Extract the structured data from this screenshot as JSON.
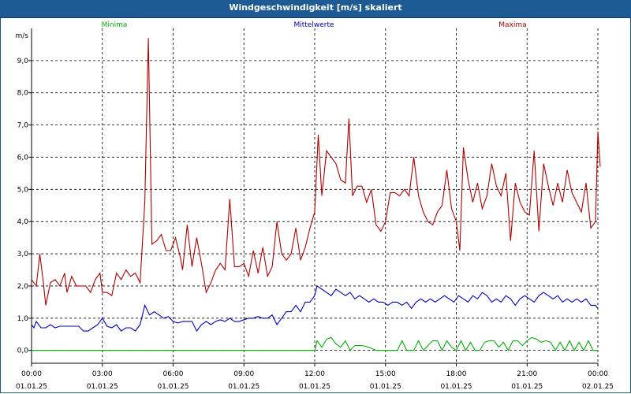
{
  "window": {
    "title": "Windgeschwindigkeit [m/s] skaliert"
  },
  "chart_data": {
    "type": "line",
    "title": "Windgeschwindigkeit [m/s] skaliert",
    "ylabel": "m/s",
    "ylim": [
      -0.4,
      10.0
    ],
    "y_ticks": [
      "0,0",
      "1,0",
      "2,0",
      "3,0",
      "4,0",
      "5,0",
      "6,0",
      "7,0",
      "8,0",
      "9,0"
    ],
    "y_tick_values": [
      0,
      1,
      2,
      3,
      4,
      5,
      6,
      7,
      8,
      9
    ],
    "x_range_hours": [
      0,
      24
    ],
    "x_ticks": [
      {
        "time": "00:00",
        "date": "01.01.25",
        "hour": 0
      },
      {
        "time": "03:00",
        "date": "01.01.25",
        "hour": 3
      },
      {
        "time": "06:00",
        "date": "01.01.25",
        "hour": 6
      },
      {
        "time": "09:00",
        "date": "01.01.25",
        "hour": 9
      },
      {
        "time": "12:00",
        "date": "01.01.25",
        "hour": 12
      },
      {
        "time": "15:00",
        "date": "01.01.25",
        "hour": 15
      },
      {
        "time": "18:00",
        "date": "01.01.25",
        "hour": 18
      },
      {
        "time": "21:00",
        "date": "01.01.25",
        "hour": 21
      },
      {
        "time": "00:00",
        "date": "02.01.25",
        "hour": 24
      }
    ],
    "grid": true,
    "legend_position": "top",
    "series": [
      {
        "name": "Minima",
        "color": "#00b000",
        "points": [
          [
            0,
            0.0
          ],
          [
            12,
            0.0
          ],
          [
            12.1,
            0.3
          ],
          [
            12.3,
            0.1
          ],
          [
            12.5,
            0.35
          ],
          [
            12.7,
            0.4
          ],
          [
            12.9,
            0.2
          ],
          [
            13.1,
            0.1
          ],
          [
            13.3,
            0.3
          ],
          [
            13.5,
            0.0
          ],
          [
            13.7,
            0.15
          ],
          [
            14.0,
            0.15
          ],
          [
            14.3,
            0.1
          ],
          [
            14.6,
            0.0
          ],
          [
            15.5,
            0.0
          ],
          [
            15.7,
            0.3
          ],
          [
            15.9,
            0.0
          ],
          [
            16.2,
            0.0
          ],
          [
            16.4,
            0.3
          ],
          [
            16.6,
            0.0
          ],
          [
            16.8,
            0.15
          ],
          [
            17.0,
            0.3
          ],
          [
            17.2,
            0.3
          ],
          [
            17.4,
            0.0
          ],
          [
            17.6,
            0.3
          ],
          [
            17.8,
            0.1
          ],
          [
            18.0,
            0.0
          ],
          [
            18.2,
            0.3
          ],
          [
            18.4,
            0.0
          ],
          [
            18.6,
            0.25
          ],
          [
            18.8,
            0.0
          ],
          [
            19.0,
            0.0
          ],
          [
            19.2,
            0.25
          ],
          [
            19.4,
            0.3
          ],
          [
            19.6,
            0.3
          ],
          [
            19.8,
            0.1
          ],
          [
            20.0,
            0.25
          ],
          [
            20.2,
            0.0
          ],
          [
            20.4,
            0.3
          ],
          [
            20.6,
            0.3
          ],
          [
            20.8,
            0.15
          ],
          [
            21.0,
            0.3
          ],
          [
            21.2,
            0.4
          ],
          [
            21.4,
            0.35
          ],
          [
            21.6,
            0.25
          ],
          [
            21.8,
            0.3
          ],
          [
            22.0,
            0.25
          ],
          [
            22.2,
            0.0
          ],
          [
            22.4,
            0.25
          ],
          [
            22.6,
            0.0
          ],
          [
            22.8,
            0.3
          ],
          [
            23.0,
            0.0
          ],
          [
            23.2,
            0.25
          ],
          [
            23.4,
            0.0
          ],
          [
            23.6,
            0.3
          ],
          [
            23.8,
            0.0
          ],
          [
            24.0,
            0.0
          ]
        ]
      },
      {
        "name": "Mittelwerte",
        "color": "#0000c0",
        "points": [
          [
            0,
            0.8
          ],
          [
            0.1,
            0.7
          ],
          [
            0.2,
            0.9
          ],
          [
            0.4,
            0.7
          ],
          [
            0.6,
            0.7
          ],
          [
            0.8,
            0.8
          ],
          [
            1.0,
            0.7
          ],
          [
            1.2,
            0.75
          ],
          [
            1.4,
            0.75
          ],
          [
            1.6,
            0.75
          ],
          [
            1.8,
            0.75
          ],
          [
            2.0,
            0.75
          ],
          [
            2.2,
            0.6
          ],
          [
            2.4,
            0.6
          ],
          [
            2.6,
            0.7
          ],
          [
            2.8,
            0.8
          ],
          [
            3.0,
            1.0
          ],
          [
            3.2,
            0.75
          ],
          [
            3.4,
            0.7
          ],
          [
            3.6,
            0.8
          ],
          [
            3.8,
            0.6
          ],
          [
            4.0,
            0.7
          ],
          [
            4.2,
            0.7
          ],
          [
            4.4,
            0.6
          ],
          [
            4.6,
            0.8
          ],
          [
            4.8,
            1.4
          ],
          [
            5.0,
            1.1
          ],
          [
            5.2,
            1.2
          ],
          [
            5.4,
            1.1
          ],
          [
            5.6,
            1.0
          ],
          [
            5.8,
            1.05
          ],
          [
            6.0,
            0.9
          ],
          [
            6.2,
            0.85
          ],
          [
            6.4,
            0.9
          ],
          [
            6.6,
            0.9
          ],
          [
            6.8,
            0.9
          ],
          [
            7.0,
            0.6
          ],
          [
            7.2,
            0.8
          ],
          [
            7.4,
            0.9
          ],
          [
            7.6,
            0.8
          ],
          [
            7.8,
            0.9
          ],
          [
            8.0,
            0.95
          ],
          [
            8.2,
            0.9
          ],
          [
            8.4,
            1.0
          ],
          [
            8.6,
            0.9
          ],
          [
            8.8,
            0.9
          ],
          [
            9.0,
            0.95
          ],
          [
            9.2,
            1.0
          ],
          [
            9.4,
            1.0
          ],
          [
            9.6,
            1.05
          ],
          [
            9.8,
            1.0
          ],
          [
            10.0,
            1.0
          ],
          [
            10.2,
            1.1
          ],
          [
            10.4,
            0.8
          ],
          [
            10.6,
            1.0
          ],
          [
            10.8,
            1.2
          ],
          [
            11.0,
            1.2
          ],
          [
            11.2,
            1.4
          ],
          [
            11.4,
            1.2
          ],
          [
            11.6,
            1.5
          ],
          [
            11.8,
            1.5
          ],
          [
            12.0,
            1.7
          ],
          [
            12.1,
            2.0
          ],
          [
            12.3,
            1.9
          ],
          [
            12.5,
            1.8
          ],
          [
            12.7,
            1.7
          ],
          [
            12.9,
            1.9
          ],
          [
            13.1,
            1.8
          ],
          [
            13.3,
            1.7
          ],
          [
            13.5,
            1.8
          ],
          [
            13.7,
            1.6
          ],
          [
            13.9,
            1.7
          ],
          [
            14.1,
            1.6
          ],
          [
            14.3,
            1.5
          ],
          [
            14.5,
            1.6
          ],
          [
            14.7,
            1.5
          ],
          [
            14.9,
            1.5
          ],
          [
            15.1,
            1.4
          ],
          [
            15.3,
            1.5
          ],
          [
            15.5,
            1.5
          ],
          [
            15.7,
            1.4
          ],
          [
            15.9,
            1.5
          ],
          [
            16.1,
            1.3
          ],
          [
            16.3,
            1.5
          ],
          [
            16.5,
            1.6
          ],
          [
            16.7,
            1.5
          ],
          [
            16.9,
            1.6
          ],
          [
            17.1,
            1.5
          ],
          [
            17.3,
            1.6
          ],
          [
            17.5,
            1.7
          ],
          [
            17.7,
            1.6
          ],
          [
            17.9,
            1.5
          ],
          [
            18.1,
            1.7
          ],
          [
            18.3,
            1.6
          ],
          [
            18.5,
            1.5
          ],
          [
            18.7,
            1.7
          ],
          [
            18.9,
            1.6
          ],
          [
            19.1,
            1.8
          ],
          [
            19.3,
            1.7
          ],
          [
            19.5,
            1.5
          ],
          [
            19.7,
            1.6
          ],
          [
            19.9,
            1.5
          ],
          [
            20.1,
            1.7
          ],
          [
            20.3,
            1.6
          ],
          [
            20.5,
            1.4
          ],
          [
            20.7,
            1.6
          ],
          [
            20.9,
            1.7
          ],
          [
            21.1,
            1.6
          ],
          [
            21.3,
            1.5
          ],
          [
            21.5,
            1.7
          ],
          [
            21.7,
            1.8
          ],
          [
            21.9,
            1.7
          ],
          [
            22.1,
            1.6
          ],
          [
            22.3,
            1.7
          ],
          [
            22.5,
            1.5
          ],
          [
            22.7,
            1.6
          ],
          [
            22.9,
            1.5
          ],
          [
            23.1,
            1.6
          ],
          [
            23.3,
            1.5
          ],
          [
            23.5,
            1.6
          ],
          [
            23.7,
            1.4
          ],
          [
            23.9,
            1.4
          ],
          [
            24.0,
            1.3
          ]
        ]
      },
      {
        "name": "Maxima",
        "color": "#b00000",
        "points": [
          [
            0,
            2.2
          ],
          [
            0.2,
            2.0
          ],
          [
            0.35,
            3.0
          ],
          [
            0.5,
            2.1
          ],
          [
            0.6,
            1.4
          ],
          [
            0.8,
            2.1
          ],
          [
            1.0,
            2.2
          ],
          [
            1.2,
            2.0
          ],
          [
            1.4,
            2.4
          ],
          [
            1.5,
            1.8
          ],
          [
            1.7,
            2.3
          ],
          [
            1.9,
            2.0
          ],
          [
            2.1,
            2.0
          ],
          [
            2.3,
            2.0
          ],
          [
            2.5,
            1.8
          ],
          [
            2.7,
            2.2
          ],
          [
            2.9,
            2.4
          ],
          [
            3.0,
            1.8
          ],
          [
            3.2,
            1.8
          ],
          [
            3.4,
            1.7
          ],
          [
            3.6,
            2.4
          ],
          [
            3.8,
            2.2
          ],
          [
            4.0,
            2.5
          ],
          [
            4.2,
            2.3
          ],
          [
            4.4,
            2.4
          ],
          [
            4.6,
            2.1
          ],
          [
            4.8,
            4.6
          ],
          [
            4.95,
            9.7
          ],
          [
            5.1,
            3.3
          ],
          [
            5.3,
            3.4
          ],
          [
            5.5,
            3.6
          ],
          [
            5.7,
            3.1
          ],
          [
            5.9,
            3.1
          ],
          [
            6.1,
            3.5
          ],
          [
            6.3,
            2.9
          ],
          [
            6.4,
            2.5
          ],
          [
            6.6,
            3.9
          ],
          [
            6.8,
            2.6
          ],
          [
            7.0,
            3.5
          ],
          [
            7.2,
            2.7
          ],
          [
            7.4,
            1.8
          ],
          [
            7.6,
            2.1
          ],
          [
            7.8,
            2.5
          ],
          [
            8.0,
            2.7
          ],
          [
            8.2,
            2.5
          ],
          [
            8.4,
            4.7
          ],
          [
            8.6,
            2.6
          ],
          [
            8.8,
            2.6
          ],
          [
            9.0,
            2.7
          ],
          [
            9.2,
            2.3
          ],
          [
            9.4,
            3.1
          ],
          [
            9.6,
            2.4
          ],
          [
            9.8,
            3.2
          ],
          [
            10.0,
            2.3
          ],
          [
            10.2,
            2.6
          ],
          [
            10.4,
            4.0
          ],
          [
            10.6,
            3.0
          ],
          [
            10.8,
            2.8
          ],
          [
            11.0,
            3.0
          ],
          [
            11.2,
            3.8
          ],
          [
            11.4,
            2.8
          ],
          [
            11.6,
            3.2
          ],
          [
            11.8,
            3.8
          ],
          [
            12.0,
            4.3
          ],
          [
            12.15,
            6.7
          ],
          [
            12.3,
            4.8
          ],
          [
            12.5,
            6.2
          ],
          [
            12.7,
            6.0
          ],
          [
            12.9,
            5.8
          ],
          [
            13.1,
            5.3
          ],
          [
            13.3,
            5.2
          ],
          [
            13.45,
            7.2
          ],
          [
            13.6,
            4.8
          ],
          [
            13.8,
            5.1
          ],
          [
            14.0,
            5.1
          ],
          [
            14.2,
            4.6
          ],
          [
            14.4,
            5.0
          ],
          [
            14.6,
            3.9
          ],
          [
            14.8,
            3.7
          ],
          [
            15.0,
            4.0
          ],
          [
            15.2,
            4.9
          ],
          [
            15.4,
            4.9
          ],
          [
            15.6,
            4.8
          ],
          [
            15.8,
            5.0
          ],
          [
            16.0,
            4.8
          ],
          [
            16.2,
            6.0
          ],
          [
            16.4,
            4.8
          ],
          [
            16.6,
            4.3
          ],
          [
            16.8,
            4.0
          ],
          [
            17.0,
            3.9
          ],
          [
            17.2,
            4.3
          ],
          [
            17.4,
            4.5
          ],
          [
            17.6,
            5.6
          ],
          [
            17.8,
            4.4
          ],
          [
            18.0,
            4.0
          ],
          [
            18.15,
            3.1
          ],
          [
            18.3,
            6.3
          ],
          [
            18.5,
            5.3
          ],
          [
            18.7,
            4.6
          ],
          [
            18.9,
            5.2
          ],
          [
            19.1,
            4.4
          ],
          [
            19.3,
            4.8
          ],
          [
            19.5,
            5.8
          ],
          [
            19.7,
            5.1
          ],
          [
            19.9,
            4.8
          ],
          [
            20.1,
            5.5
          ],
          [
            20.3,
            3.4
          ],
          [
            20.5,
            5.2
          ],
          [
            20.7,
            4.6
          ],
          [
            20.9,
            4.3
          ],
          [
            21.1,
            4.2
          ],
          [
            21.3,
            6.2
          ],
          [
            21.5,
            3.7
          ],
          [
            21.7,
            5.8
          ],
          [
            21.9,
            5.1
          ],
          [
            22.1,
            4.5
          ],
          [
            22.3,
            5.2
          ],
          [
            22.5,
            4.6
          ],
          [
            22.7,
            5.6
          ],
          [
            22.9,
            4.9
          ],
          [
            23.1,
            4.6
          ],
          [
            23.3,
            4.3
          ],
          [
            23.5,
            5.2
          ],
          [
            23.7,
            3.8
          ],
          [
            23.9,
            4.0
          ],
          [
            24.0,
            6.8
          ],
          [
            24.1,
            5.7
          ]
        ]
      }
    ]
  }
}
